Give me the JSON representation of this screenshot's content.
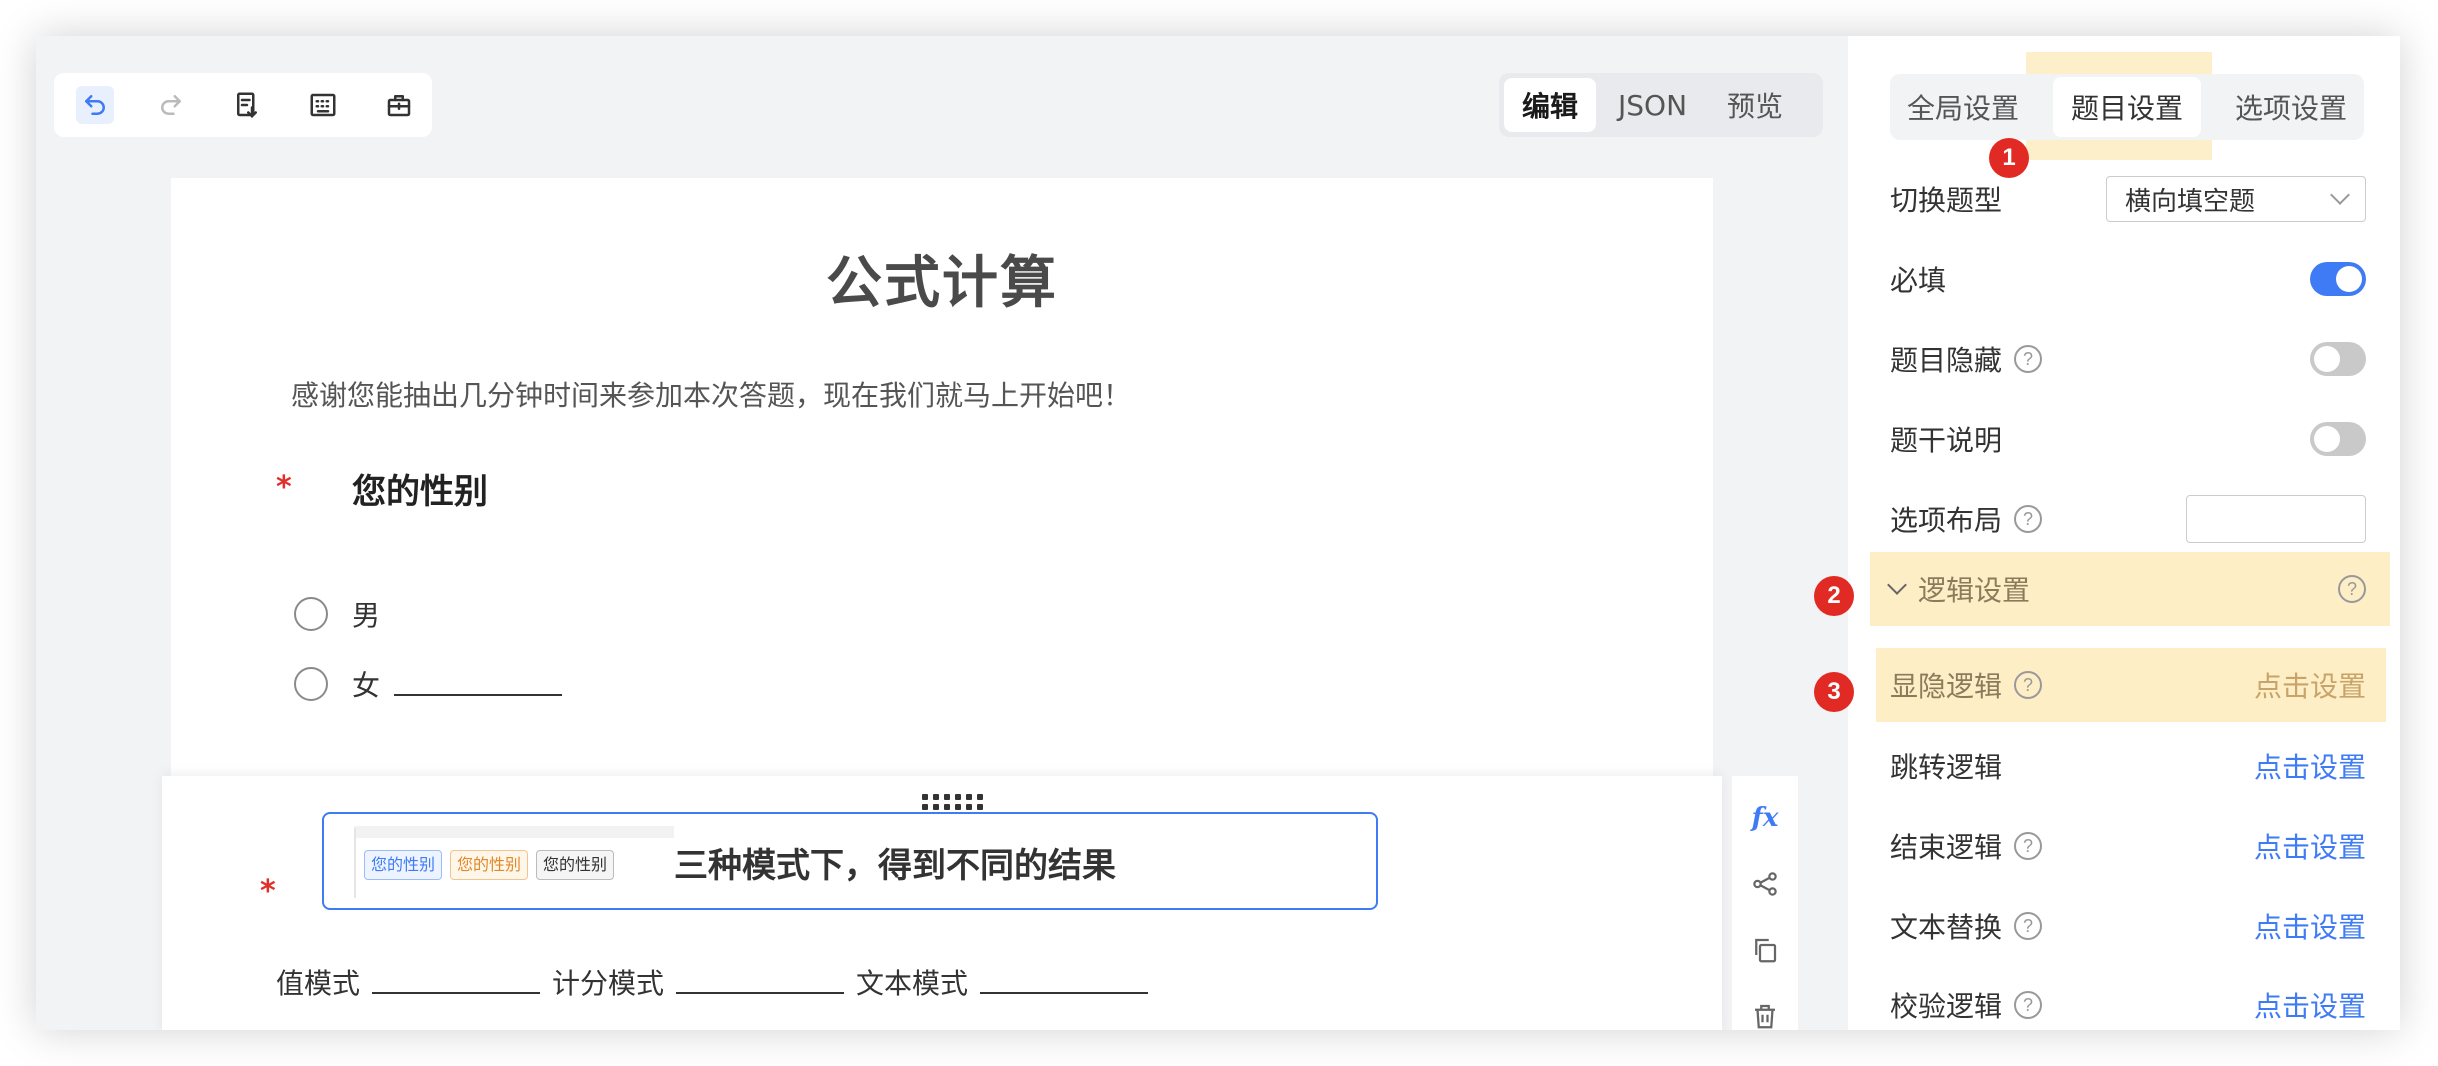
{
  "toolbar": {
    "icons": [
      "undo-icon",
      "redo-icon",
      "import-icon",
      "keyboard-icon",
      "toolbox-icon"
    ]
  },
  "mode_switch": {
    "tabs": [
      "编辑",
      "JSON",
      "预览"
    ],
    "active": "编辑"
  },
  "survey": {
    "title": "公式计算",
    "intro": "感谢您能抽出几分钟时间来参加本次答题，现在我们就马上开始吧！",
    "q1": {
      "required_mark": "*",
      "title": "您的性别",
      "options": [
        "男",
        "女"
      ]
    },
    "q2": {
      "required_mark": "*",
      "tags": [
        "您的性别",
        "您的性别",
        "您的性别"
      ],
      "title": "三种模式下，得到不同的结果",
      "modes": [
        "值模式",
        "计分模式",
        "文本模式"
      ]
    }
  },
  "side_actions": {
    "fx_label": "fx",
    "icons": [
      "fx-icon",
      "share-icon",
      "copy-icon",
      "delete-icon"
    ]
  },
  "panel": {
    "tabs": [
      "全局设置",
      "题目设置",
      "选项设置"
    ],
    "active_tab": "题目设置",
    "badges": [
      "1",
      "2",
      "3"
    ],
    "switch_type": {
      "label": "切换题型",
      "value": "横向填空题"
    },
    "required": {
      "label": "必填",
      "on": true
    },
    "hidden": {
      "label": "题目隐藏",
      "on": false
    },
    "desc": {
      "label": "题干说明",
      "on": false
    },
    "layout": {
      "label": "选项布局"
    },
    "logic_section": {
      "label": "逻辑设置"
    },
    "logic_rows": [
      {
        "label": "显隐逻辑",
        "action": "点击设置"
      },
      {
        "label": "跳转逻辑",
        "action": "点击设置"
      },
      {
        "label": "结束逻辑",
        "action": "点击设置"
      },
      {
        "label": "文本替换",
        "action": "点击设置"
      },
      {
        "label": "校验逻辑",
        "action": "点击设置"
      }
    ],
    "help_mark": "?",
    "accent": "#3e7bf5",
    "highlight": "#fde2a0",
    "badge_color": "#e02a23"
  }
}
